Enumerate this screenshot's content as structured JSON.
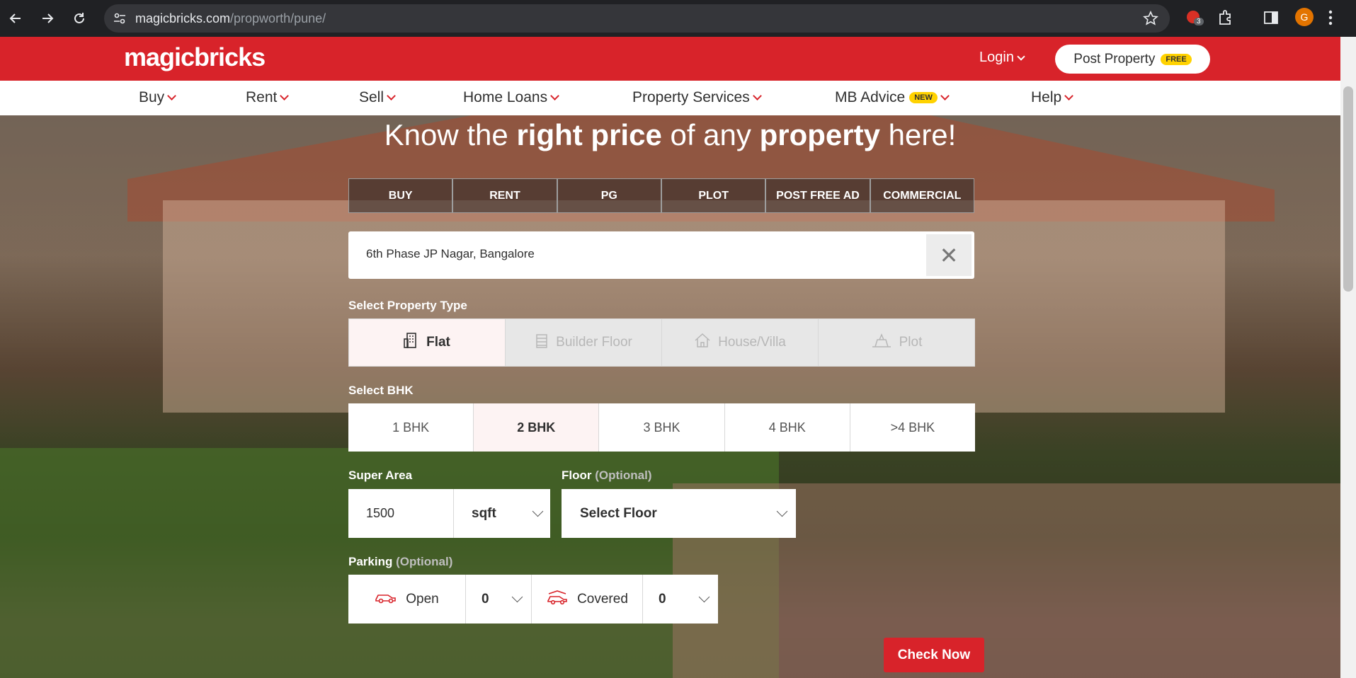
{
  "browser": {
    "url_host": "magicbricks.com",
    "url_path": "/propworth/pune/",
    "extension_badge": "3",
    "profile_initial": "G"
  },
  "header": {
    "logo": "magicbricks",
    "login_label": "Login",
    "post_property_label": "Post Property",
    "post_property_badge": "FREE"
  },
  "menu": {
    "buy": "Buy",
    "rent": "Rent",
    "sell": "Sell",
    "home_loans": "Home Loans",
    "property_services": "Property Services",
    "mb_advice": "MB Advice",
    "mb_advice_badge": "NEW",
    "help": "Help"
  },
  "hero": {
    "title_1": "Know the ",
    "title_2": "right price",
    "title_3": " of any ",
    "title_4": "property",
    "title_5": " here!"
  },
  "tabs": [
    "BUY",
    "RENT",
    "PG",
    "PLOT",
    "POST FREE AD",
    "COMMERCIAL"
  ],
  "search": {
    "value": "6th Phase JP Nagar, Bangalore",
    "clear_symbol": "✕"
  },
  "property_type": {
    "label": "Select Property Type",
    "options": [
      "Flat",
      "Builder Floor",
      "House/Villa",
      "Plot"
    ],
    "selected": "Flat"
  },
  "bhk": {
    "label": "Select BHK",
    "options": [
      "1 BHK",
      "2 BHK",
      "3 BHK",
      "4 BHK",
      ">4 BHK"
    ],
    "selected": "2 BHK"
  },
  "super_area": {
    "label": "Super Area",
    "value": "1500",
    "unit": "sqft"
  },
  "floor": {
    "label": "Floor",
    "optional": "(Optional)",
    "value": "Select Floor"
  },
  "parking": {
    "label": "Parking",
    "optional": "(Optional)",
    "open_label": "Open",
    "open_value": "0",
    "covered_label": "Covered",
    "covered_value": "0"
  },
  "check_now_label": "Check Now",
  "colors": {
    "brand_red": "#d8232a",
    "badge_yellow": "#ffd200"
  }
}
